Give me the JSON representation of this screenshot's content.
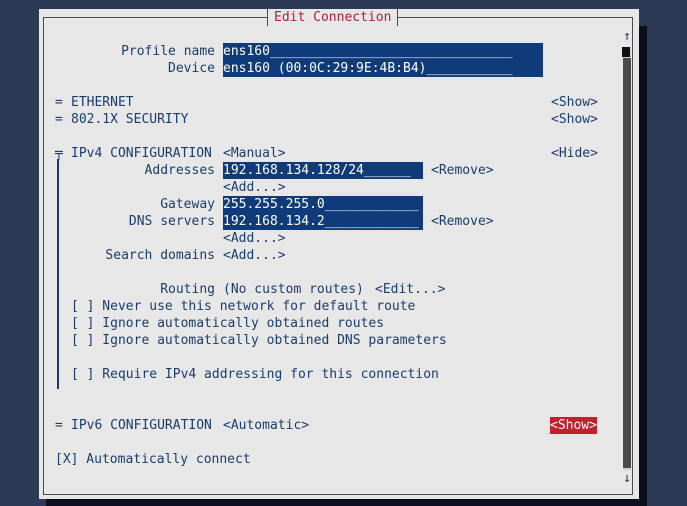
{
  "title": "Edit Connection",
  "profile": {
    "label": "Profile name",
    "value": "ens160_______________________________"
  },
  "device": {
    "label": "Device",
    "value": "ens160 (00:0C:29:9E:4B:B4)___________"
  },
  "ethernet": {
    "label": "ETHERNET",
    "toggle": "<Show>"
  },
  "security": {
    "label": "802.1X SECURITY",
    "toggle": "<Show>"
  },
  "ipv4": {
    "label": "IPv4 CONFIGURATION",
    "method": "<Manual>",
    "toggle": "<Hide>",
    "addresses_label": "Addresses",
    "address_value": "192.168.134.128/24______",
    "remove": "<Remove>",
    "add": "<Add...>",
    "gateway_label": "Gateway",
    "gateway_value": "255.255.255.0____________",
    "dns_label": "DNS servers",
    "dns_value": "192.168.134.2____________",
    "dns_remove": "<Remove>",
    "dns_add": "<Add...>",
    "search_label": "Search domains",
    "search_add": "<Add...>",
    "routing_label": "Routing",
    "routing_value": "(No custom routes)",
    "routing_edit": "<Edit...>",
    "never_default": "[ ] Never use this network for default route",
    "ignore_routes": "[ ] Ignore automatically obtained routes",
    "ignore_dns": "[ ] Ignore automatically obtained DNS parameters",
    "require": "[ ] Require IPv4 addressing for this connection"
  },
  "ipv6": {
    "label": "IPv6 CONFIGURATION",
    "method": "<Automatic>",
    "toggle": "<Show>"
  },
  "autoconnect": "[X] Automatically connect",
  "section_mark": "=",
  "section_mark_open": "╤",
  "scroll_up": "↑",
  "scroll_down": "↓",
  "colors": {
    "background": "#2c3a56",
    "dialog": "#e7e7e7",
    "field": "#0f3b7a",
    "focus": "#c2202e",
    "text": "#1a3d6b",
    "title": "#b0203a"
  }
}
